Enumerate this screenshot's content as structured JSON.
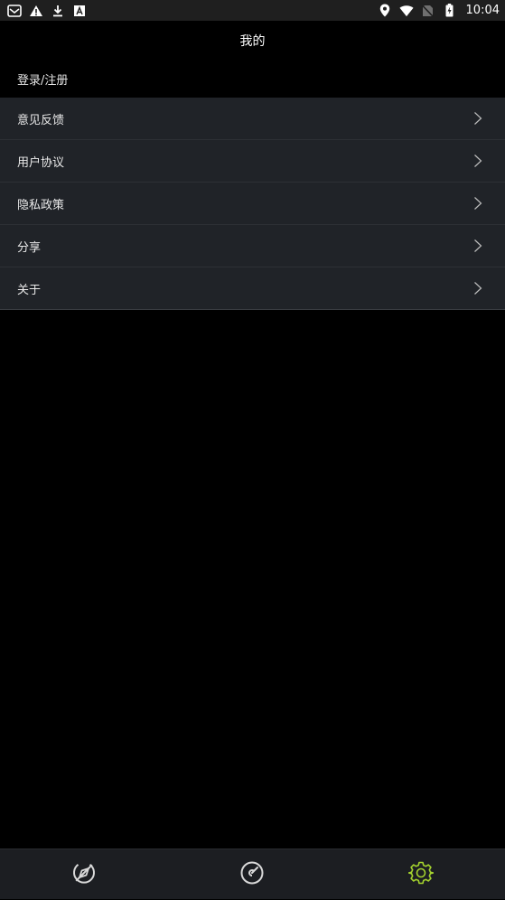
{
  "status_bar": {
    "time": "10:04",
    "left_icons": [
      "mail-icon",
      "warning-icon",
      "download-icon",
      "font-app-icon"
    ],
    "right_icons": [
      "location-icon",
      "wifi-icon",
      "no-sim-icon",
      "battery-icon"
    ]
  },
  "header": {
    "title": "我的"
  },
  "login": {
    "label": "登录/注册"
  },
  "menu": {
    "items": [
      {
        "label": "意见反馈"
      },
      {
        "label": "用户协议"
      },
      {
        "label": "隐私政策"
      },
      {
        "label": "分享"
      },
      {
        "label": "关于"
      }
    ]
  },
  "bottom_nav": {
    "tabs": [
      {
        "icon": "compass-icon",
        "active": false
      },
      {
        "icon": "speedometer-icon",
        "active": false
      },
      {
        "icon": "settings-gear-icon",
        "active": true
      }
    ],
    "colors": {
      "inactive": "#d8d8d8",
      "active": "#a4d22e"
    }
  }
}
